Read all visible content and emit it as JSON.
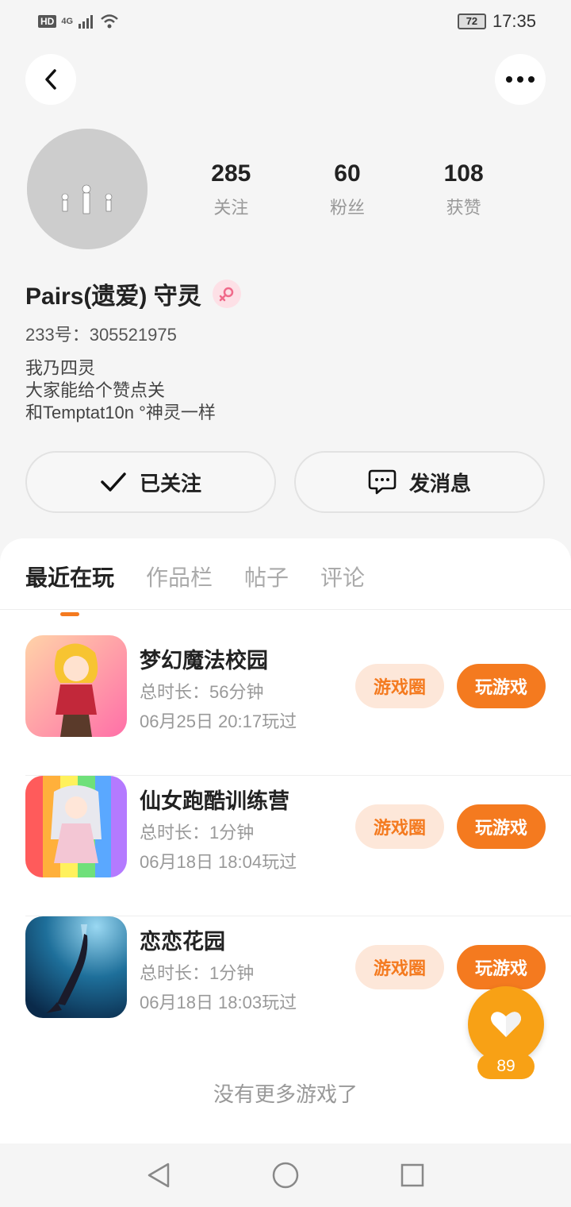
{
  "status_bar": {
    "hd_label": "HD",
    "network_label": "4G",
    "battery": "72",
    "time": "17:35"
  },
  "profile": {
    "stats": [
      {
        "value": "285",
        "label": "关注"
      },
      {
        "value": "60",
        "label": "粉丝"
      },
      {
        "value": "108",
        "label": "获赞"
      }
    ],
    "username": "Pairs(遗爱) 守灵",
    "uid": "233号：305521975",
    "bio_lines": [
      "我乃四灵",
      "大家能给个赞点关",
      "和Temptat10n °神灵一样"
    ],
    "follow_label": "已关注",
    "message_label": "发消息"
  },
  "tabs": [
    {
      "label": "最近在玩",
      "active": true
    },
    {
      "label": "作品栏",
      "active": false
    },
    {
      "label": "帖子",
      "active": false
    },
    {
      "label": "评论",
      "active": false
    }
  ],
  "games": [
    {
      "title": "梦幻魔法校园",
      "duration": "总时长：56分钟",
      "played": "06月25日 20:17玩过",
      "circle_label": "游戏圈",
      "play_label": "玩游戏"
    },
    {
      "title": "仙女跑酷训练营",
      "duration": "总时长：1分钟",
      "played": "06月18日 18:04玩过",
      "circle_label": "游戏圈",
      "play_label": "玩游戏"
    },
    {
      "title": "恋恋花园",
      "duration": "总时长：1分钟",
      "played": "06月18日 18:03玩过",
      "circle_label": "游戏圈",
      "play_label": "玩游戏"
    }
  ],
  "no_more_text": "没有更多游戏了",
  "like_count": "89",
  "colors": {
    "accent": "#f47a1f",
    "accent_light": "#fde7d9",
    "like": "#f8a115"
  }
}
